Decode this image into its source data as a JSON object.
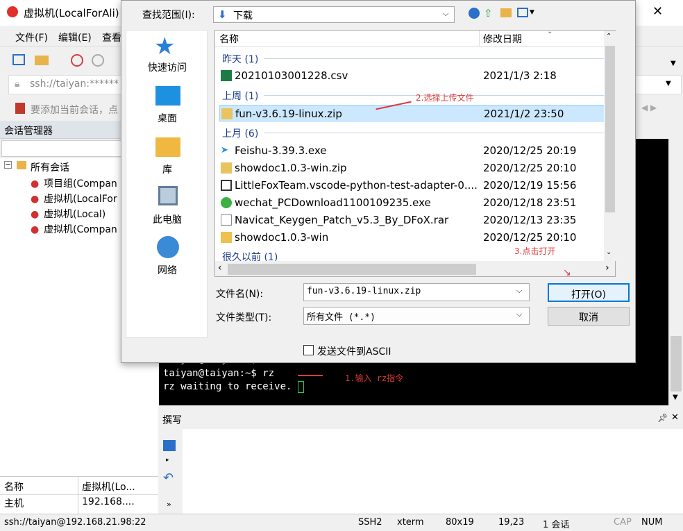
{
  "app": {
    "title": "虚拟机(LocalForAli)",
    "menu": [
      "文件(F)",
      "编辑(E)",
      "查看"
    ],
    "address": "ssh://taiyan:******",
    "fav_hint": "要添加当前会话，点"
  },
  "session_manager": {
    "title": "会话管理器",
    "root": "所有会话",
    "items": [
      "项目组(Compan",
      "虚拟机(LocalFor",
      "虚拟机(Local)",
      "虚拟机(Compan"
    ]
  },
  "properties": {
    "rows": [
      {
        "key": "名称",
        "value": "虚拟机(Lo..."
      },
      {
        "key": "主机",
        "value": "192.168...."
      }
    ]
  },
  "terminal": {
    "lines": [
      "taiyan@taiyan:~$",
      "taiyan@taiyan:~$ rz",
      "rz waiting to receive."
    ],
    "annotation": "1.输入 rz指令"
  },
  "compose": {
    "title": "撰写"
  },
  "status": {
    "connection": "ssh://taiyan@192.168.21.98:22",
    "protocol": "SSH2",
    "term": "xterm",
    "size": "80x19",
    "cursor": "19,23",
    "sessions": "1 会话",
    "cap": "CAP",
    "num": "NUM"
  },
  "dialog": {
    "lookin_label": "查找范围(I):",
    "lookin_value": "下载",
    "places": [
      "快速访问",
      "桌面",
      "库",
      "此电脑",
      "网络"
    ],
    "columns": {
      "name": "名称",
      "date": "修改日期"
    },
    "groups": [
      "昨天 (1)",
      "上周 (1)",
      "上月 (6)",
      "很久以前 (1)"
    ],
    "files": [
      {
        "name": "20210103001228.csv",
        "date": "2021/1/3 2:18"
      },
      {
        "name": "fun-v3.6.19-linux.zip",
        "date": "2021/1/2 23:50"
      },
      {
        "name": "Feishu-3.39.3.exe",
        "date": "2020/12/25 20:19"
      },
      {
        "name": "showdoc1.0.3-win.zip",
        "date": "2020/12/25 20:10"
      },
      {
        "name": "LittleFoxTeam.vscode-python-test-adapter-0....",
        "date": "2020/12/19 15:56"
      },
      {
        "name": "wechat_PCDownload1100109235.exe",
        "date": "2020/12/18 23:51"
      },
      {
        "name": "Navicat_Keygen_Patch_v5.3_By_DFoX.rar",
        "date": "2020/12/13 23:35"
      },
      {
        "name": "showdoc1.0.3-win",
        "date": "2020/12/25 20:10"
      }
    ],
    "filename_label": "文件名(N):",
    "filename_value": "fun-v3.6.19-linux.zip",
    "filetype_label": "文件类型(T):",
    "filetype_value": "所有文件 (*.*)",
    "open_button": "打开(O)",
    "cancel_button": "取消",
    "ascii_checkbox": "发送文件到ASCII",
    "annotation_select": "2.选择上传文件",
    "annotation_open": "3.点击打开"
  }
}
